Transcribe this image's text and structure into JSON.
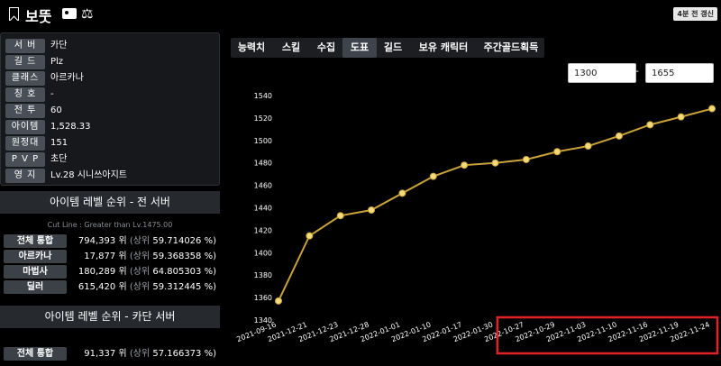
{
  "header": {
    "name": "보뚯",
    "updated": "4분 전 갱신"
  },
  "profile": [
    {
      "label": "서 버",
      "value": "카단"
    },
    {
      "label": "길 드",
      "value": "Plz"
    },
    {
      "label": "클래스",
      "value": "아르카나"
    },
    {
      "label": "칭 호",
      "value": "-"
    },
    {
      "label": "전 투",
      "value": "60"
    },
    {
      "label": "아이템",
      "value": "1,528.33"
    },
    {
      "label": "원정대",
      "value": "151"
    },
    {
      "label": "P V P",
      "value": "초단"
    },
    {
      "label": "영 지",
      "value": "Lv.28 시니쓰아지트"
    }
  ],
  "ranking_all": {
    "title": "아이템 레벨 순위 - 전 서버",
    "cutline": "Cut Line : Greater than Lv.1475.00",
    "rows": [
      {
        "label": "전체 통합",
        "rank": "794,393 위",
        "pct_prefix": "(상위",
        "pct": "59.714026 %)"
      },
      {
        "label": "아르카나",
        "rank": "17,877 위",
        "pct_prefix": "(상위",
        "pct": "59.368358 %)"
      },
      {
        "label": "마법사",
        "rank": "180,289 위",
        "pct_prefix": "(상위",
        "pct": "64.805303 %)"
      },
      {
        "label": "딜러",
        "rank": "615,420 위",
        "pct_prefix": "(상위",
        "pct": "59.312445 %)"
      }
    ]
  },
  "ranking_server": {
    "title": "아이템 레벨 순위 - 카단 서버",
    "rows": [
      {
        "label": "전체 통합",
        "rank": "91,337 위",
        "pct_prefix": "(상위",
        "pct": "57.166373 %)"
      }
    ]
  },
  "tabs": [
    "능력치",
    "스킬",
    "수집",
    "도표",
    "길드",
    "보유 캐릭터",
    "주간골드획득"
  ],
  "active_tab": "도표",
  "range": {
    "min": "1300",
    "max": "1655",
    "separator": "-"
  },
  "colors": {
    "line": "#c9a23c",
    "point": "#f5dc7a",
    "highlight_box": "#e0222b"
  },
  "chart_data": {
    "type": "line",
    "x": [
      "2021-09-16",
      "2021-12-21",
      "2021-12-23",
      "2021-12-28",
      "2022-01-01",
      "2022-01-10",
      "2022-01-17",
      "2022-01-30",
      "2022-10-27",
      "2022-10-29",
      "2022-11-03",
      "2022-11-10",
      "2022-11-16",
      "2022-11-19",
      "2022-11-24"
    ],
    "values": [
      1357,
      1415,
      1433,
      1438,
      1453,
      1468,
      1478,
      1480,
      1483,
      1490,
      1495,
      1504,
      1514,
      1521,
      1528.33
    ],
    "ylim": [
      1340,
      1540
    ],
    "yticks": [
      1340,
      1360,
      1380,
      1400,
      1420,
      1440,
      1460,
      1480,
      1500,
      1520,
      1540
    ],
    "grid": false,
    "highlight_range": [
      "2022-10-27",
      "2022-11-24"
    ]
  }
}
